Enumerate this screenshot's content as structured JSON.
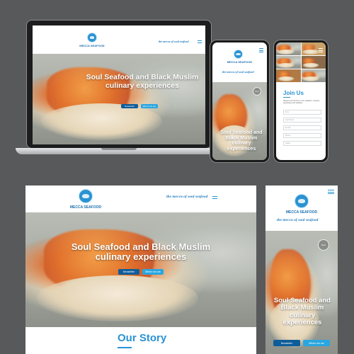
{
  "site": {
    "brand": "MECCA SEAFOOD",
    "tagline": "the mecca of soul seafood",
    "hero_title": "Soul Seafood and Black Muslim culinary experiences",
    "buttons": {
      "newsletter": "Newsletter",
      "where": "Where we are"
    },
    "next_label": "Next",
    "accent_color": "#2a93d2",
    "dark_button_color": "#0e5d9a",
    "light_button_color": "#2aa6e0"
  },
  "join": {
    "title": "Join Us",
    "description": "Please use this form to be updated, coupons, giveaways and updates",
    "fields": [
      "First",
      "Last Name",
      "E-mail",
      "Phone",
      "Select"
    ]
  },
  "story": {
    "title": "Our Story"
  }
}
